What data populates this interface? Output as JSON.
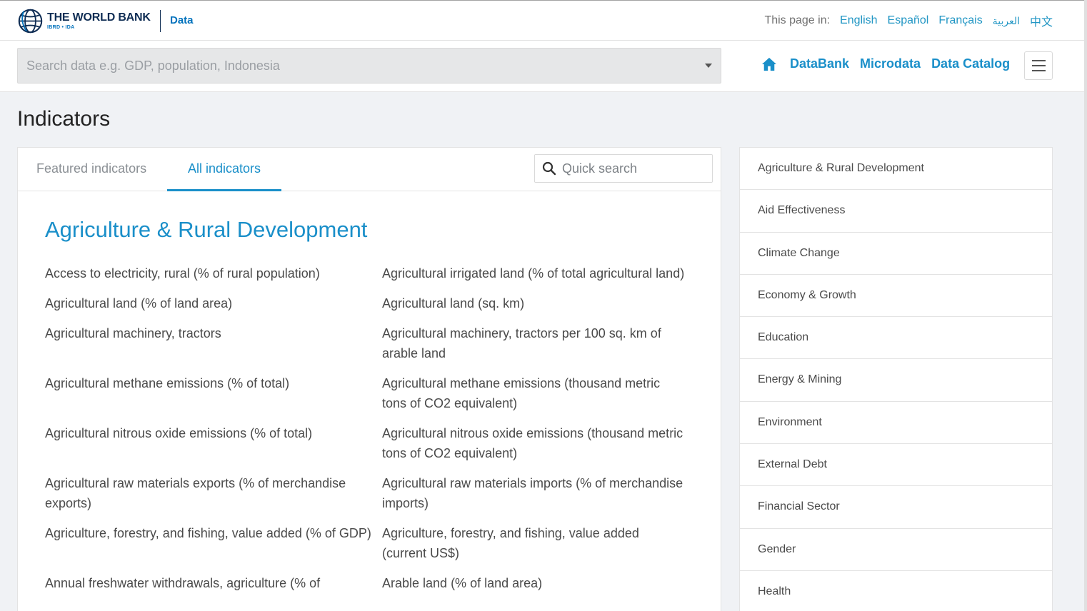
{
  "header": {
    "logo_title": "THE WORLD BANK",
    "logo_subtitle": "IBRD • IDA",
    "logo_data": "Data",
    "lang_label": "This page in:",
    "languages": [
      "English",
      "Español",
      "Français",
      "العربية",
      "中文"
    ]
  },
  "search": {
    "placeholder": "Search data e.g. GDP, population, Indonesia"
  },
  "nav": {
    "links": [
      "DataBank",
      "Microdata",
      "Data Catalog"
    ]
  },
  "page": {
    "title": "Indicators"
  },
  "tabs": {
    "featured": "Featured indicators",
    "all": "All indicators",
    "quick_search_placeholder": "Quick search"
  },
  "section": {
    "title": "Agriculture & Rural Development",
    "indicators": [
      "Access to electricity, rural (% of rural population)",
      "Agricultural irrigated land (% of total agricultural land)",
      "Agricultural land (% of land area)",
      "Agricultural land (sq. km)",
      "Agricultural machinery, tractors",
      "Agricultural machinery, tractors per 100 sq. km of arable land",
      "Agricultural methane emissions (% of total)",
      "Agricultural methane emissions (thousand metric tons of CO2 equivalent)",
      "Agricultural nitrous oxide emissions (% of total)",
      "Agricultural nitrous oxide emissions (thousand metric tons of CO2 equivalent)",
      "Agricultural raw materials exports (% of merchandise exports)",
      "Agricultural raw materials imports (% of merchandise imports)",
      "Agriculture, forestry, and fishing, value added (% of GDP)",
      "Agriculture, forestry, and fishing, value added (current US$)",
      "Annual freshwater withdrawals, agriculture (% of",
      "Arable land (% of land area)"
    ]
  },
  "sidebar": {
    "topics": [
      "Agriculture & Rural Development",
      "Aid Effectiveness",
      "Climate Change",
      "Economy & Growth",
      "Education",
      "Energy & Mining",
      "Environment",
      "External Debt",
      "Financial Sector",
      "Gender",
      "Health"
    ]
  },
  "colors": {
    "accent": "#1a8fc9",
    "brand_navy": "#0f2d54"
  }
}
